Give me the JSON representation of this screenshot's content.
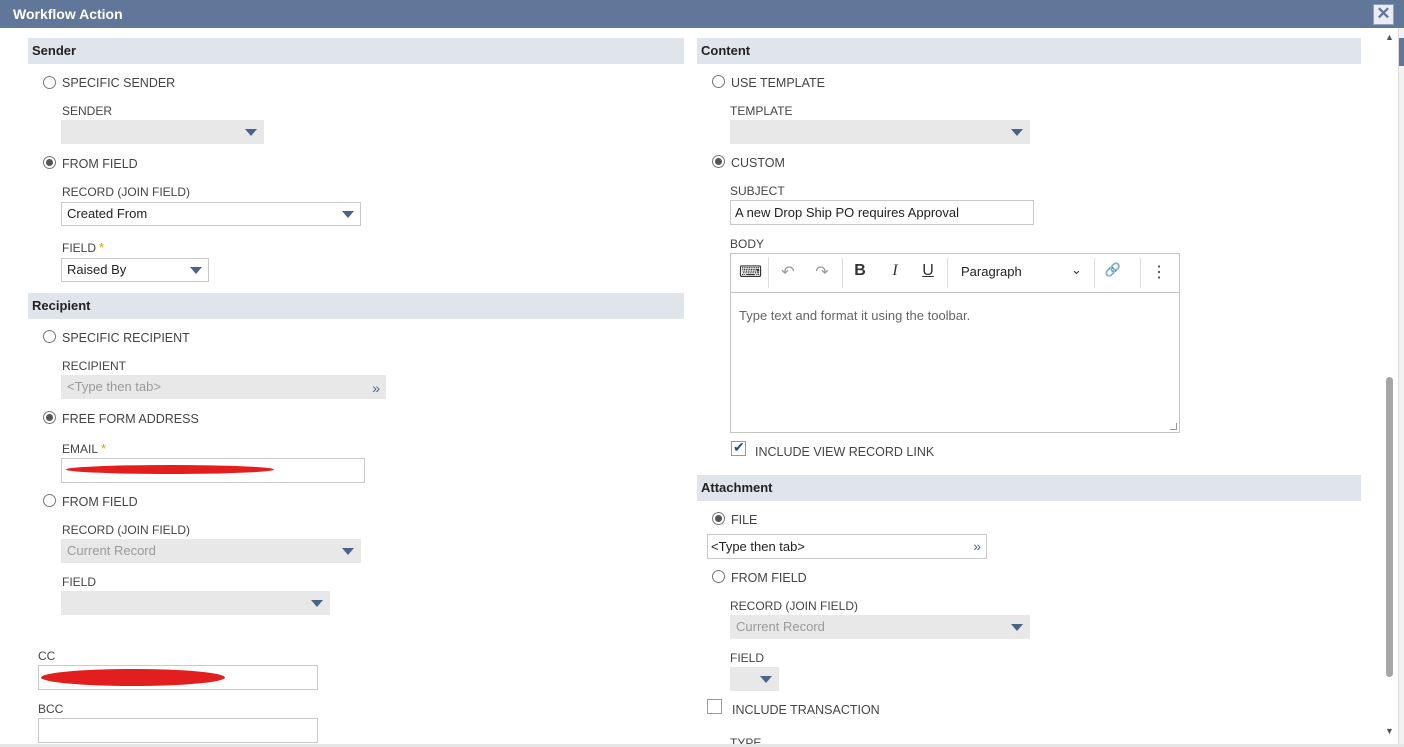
{
  "window": {
    "title": "Workflow Action",
    "close_glyph": "✕"
  },
  "sender": {
    "header": "Sender",
    "specific_sender_label": "SPECIFIC SENDER",
    "sender_label": "SENDER",
    "sender_value": "",
    "from_field_label": "FROM FIELD",
    "record_label": "RECORD (JOIN FIELD)",
    "record_value": "Created From",
    "field_label": "FIELD",
    "field_value": "Raised By",
    "selected": "from_field"
  },
  "recipient": {
    "header": "Recipient",
    "specific_recipient_label": "SPECIFIC RECIPIENT",
    "recipient_label": "RECIPIENT",
    "recipient_placeholder": "<Type then tab>",
    "free_form_label": "FREE FORM ADDRESS",
    "email_label": "EMAIL",
    "from_field_label": "FROM FIELD",
    "record_label": "RECORD (JOIN FIELD)",
    "record_value": "Current Record",
    "field_label": "FIELD",
    "field_value": "",
    "selected": "free_form"
  },
  "cc": {
    "label": "CC"
  },
  "bcc": {
    "label": "BCC"
  },
  "required_marker": "*",
  "content": {
    "header": "Content",
    "use_template_label": "USE TEMPLATE",
    "template_label": "TEMPLATE",
    "custom_label": "CUSTOM",
    "subject_label": "SUBJECT",
    "subject_value": "A new Drop Ship PO requires Approval",
    "body_label": "BODY",
    "body_placeholder": "Type text and format it using the toolbar.",
    "paragraph_label": "Paragraph",
    "include_view_record_link_label": "INCLUDE VIEW RECORD LINK",
    "include_view_record_link_checked": true,
    "selected": "custom"
  },
  "toolbar_glyphs": {
    "source": "⌨",
    "undo": "↶",
    "redo": "↷",
    "bold": "B",
    "italic": "I",
    "underline": "U",
    "chevron": "⌄",
    "link": "🔗",
    "more": "⋮"
  },
  "attachment": {
    "header": "Attachment",
    "file_label": "FILE",
    "file_placeholder": "<Type then tab>",
    "from_field_label": "FROM FIELD",
    "record_label": "RECORD (JOIN FIELD)",
    "record_value": "Current Record",
    "field_label": "FIELD",
    "include_transaction_label": "INCLUDE TRANSACTION",
    "type_label": "TYPE",
    "selected": "file"
  },
  "colors": {
    "titlebar": "#607799",
    "section_header": "#e0e4eb",
    "caret": "#4a6389",
    "required": "#e0a100",
    "redaction": "#e31e1e"
  }
}
